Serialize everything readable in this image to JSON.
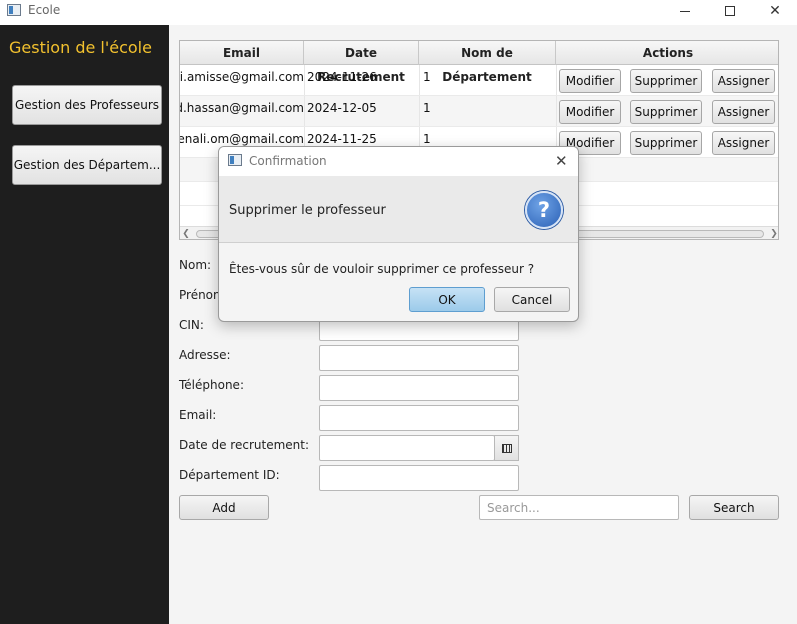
{
  "window": {
    "title": "Ecole",
    "icon": "app-window-icon",
    "controls": [
      "minimize-icon",
      "maximize-icon",
      "close-icon"
    ]
  },
  "sidebar": {
    "title": "Gestion de l'école",
    "title_color": "#f2c12e",
    "background": "#1e1e1e",
    "items": [
      {
        "label": "Gestion des Professeurs"
      },
      {
        "label": "Gestion des Départem..."
      }
    ]
  },
  "table": {
    "columns": [
      "Email",
      "Date Recrutement",
      "Nom de Département",
      "Actions"
    ],
    "rows": [
      {
        "email": "ouahbi.amisse@gmail.com",
        "date": "2024-11-26",
        "dept": "1"
      },
      {
        "email": "ahmed.hassan@gmail.com",
        "date": "2024-12-05",
        "dept": "1"
      },
      {
        "email": "sara.benali.om@gmail.com",
        "date": "2024-11-25",
        "dept": "1"
      }
    ],
    "actions": {
      "modify": "Modifier",
      "delete": "Supprimer",
      "assign": "Assigner"
    },
    "scroll_left_icon": "chevron-left-icon",
    "scroll_right_icon": "chevron-right-icon"
  },
  "form": {
    "labels": {
      "nom": "Nom:",
      "prenom": "Prénom:",
      "cin": "CIN:",
      "adresse": "Adresse:",
      "telephone": "Téléphone:",
      "email": "Email:",
      "date_recrutement": "Date de recrutement:",
      "departement_id": "Département ID:"
    },
    "values": {
      "cin": "",
      "adresse": "",
      "telephone": "",
      "email": "",
      "date_recrutement": "",
      "departement_id": ""
    },
    "calendar_icon": "calendar-icon",
    "add_label": "Add",
    "search_placeholder": "Search...",
    "search_label": "Search"
  },
  "dialog": {
    "title": "Confirmation",
    "header": "Supprimer le professeur",
    "icon": "question-icon",
    "icon_glyph": "?",
    "content": "Êtes-vous sûr de vouloir supprimer ce professeur ?",
    "ok_label": "OK",
    "cancel_label": "Cancel",
    "close_glyph": "✕",
    "accent": "#2b61b6"
  }
}
